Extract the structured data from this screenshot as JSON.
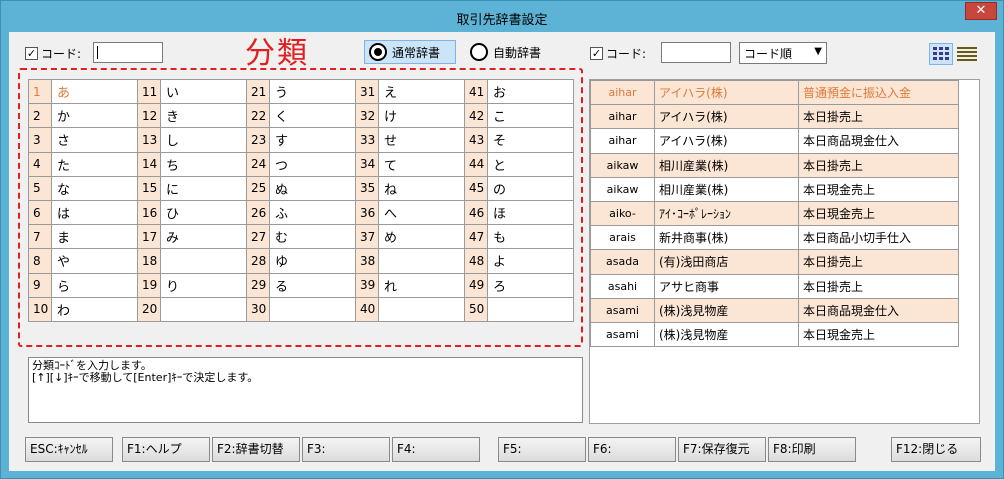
{
  "window": {
    "title": "取引先辞書設定",
    "close": "✕"
  },
  "top": {
    "left_checkbox_label": "コード:",
    "left_code_value": "",
    "bunrui_label": "分類",
    "radio_normal": "通常辞書",
    "radio_auto": "自動辞書",
    "right_checkbox_label": "コード:",
    "right_code_value": "",
    "sort_select": "コード順"
  },
  "grid": [
    [
      [
        "1",
        "あ"
      ],
      [
        "11",
        "い"
      ],
      [
        "21",
        "う"
      ],
      [
        "31",
        "え"
      ],
      [
        "41",
        "お"
      ]
    ],
    [
      [
        "2",
        "か"
      ],
      [
        "12",
        "き"
      ],
      [
        "22",
        "く"
      ],
      [
        "32",
        "け"
      ],
      [
        "42",
        "こ"
      ]
    ],
    [
      [
        "3",
        "さ"
      ],
      [
        "13",
        "し"
      ],
      [
        "23",
        "す"
      ],
      [
        "33",
        "せ"
      ],
      [
        "43",
        "そ"
      ]
    ],
    [
      [
        "4",
        "た"
      ],
      [
        "14",
        "ち"
      ],
      [
        "24",
        "つ"
      ],
      [
        "34",
        "て"
      ],
      [
        "44",
        "と"
      ]
    ],
    [
      [
        "5",
        "な"
      ],
      [
        "15",
        "に"
      ],
      [
        "25",
        "ぬ"
      ],
      [
        "35",
        "ね"
      ],
      [
        "45",
        "の"
      ]
    ],
    [
      [
        "6",
        "は"
      ],
      [
        "16",
        "ひ"
      ],
      [
        "26",
        "ふ"
      ],
      [
        "36",
        "へ"
      ],
      [
        "46",
        "ほ"
      ]
    ],
    [
      [
        "7",
        "ま"
      ],
      [
        "17",
        "み"
      ],
      [
        "27",
        "む"
      ],
      [
        "37",
        "め"
      ],
      [
        "47",
        "も"
      ]
    ],
    [
      [
        "8",
        "や"
      ],
      [
        "18",
        ""
      ],
      [
        "28",
        "ゆ"
      ],
      [
        "38",
        ""
      ],
      [
        "48",
        "よ"
      ]
    ],
    [
      [
        "9",
        "ら"
      ],
      [
        "19",
        "り"
      ],
      [
        "29",
        "る"
      ],
      [
        "39",
        "れ"
      ],
      [
        "49",
        "ろ"
      ]
    ],
    [
      [
        "10",
        "わ"
      ],
      [
        "20",
        ""
      ],
      [
        "30",
        ""
      ],
      [
        "40",
        ""
      ],
      [
        "50",
        ""
      ]
    ]
  ],
  "memo": {
    "line1": "分類ｺｰﾄﾞを入力します。",
    "line2": "[↑][↓]ｷｰで移動して[Enter]ｷｰで決定します。"
  },
  "list": [
    [
      "aihar",
      "アイハラ(株)",
      "普通預金に振込入金"
    ],
    [
      "aihar",
      "アイハラ(株)",
      "本日掛売上"
    ],
    [
      "aihar",
      "アイハラ(株)",
      "本日商品現金仕入"
    ],
    [
      "aikaw",
      "相川産業(株)",
      "本日掛売上"
    ],
    [
      "aikaw",
      "相川産業(株)",
      "本日現金売上"
    ],
    [
      "aiko-",
      "ｱｲ･ｺｰﾎﾟﾚｰｼｮﾝ",
      "本日現金売上"
    ],
    [
      "arais",
      "新井商事(株)",
      "本日商品小切手仕入"
    ],
    [
      "asada",
      "(有)浅田商店",
      "本日掛売上"
    ],
    [
      "asahi",
      "アサヒ商事",
      "本日掛売上"
    ],
    [
      "asami",
      "(株)浅見物産",
      "本日商品現金仕入"
    ],
    [
      "asami",
      "(株)浅見物産",
      "本日現金売上"
    ]
  ],
  "fkeys": {
    "esc": "ESC:ｷｬﾝｾﾙ",
    "f1": "F1:ヘルプ",
    "f2": "F2:辞書切替",
    "f3": "F3:",
    "f4": "F4:",
    "f5": "F5:",
    "f6": "F6:",
    "f7": "F7:保存復元",
    "f8": "F8:印刷",
    "f12": "F12:閉じる"
  },
  "colors": {
    "accent_red": "#e02020",
    "row_highlight": "#fbe5d4",
    "selected_text": "#e07a3a",
    "frame": "#5db3d6"
  }
}
